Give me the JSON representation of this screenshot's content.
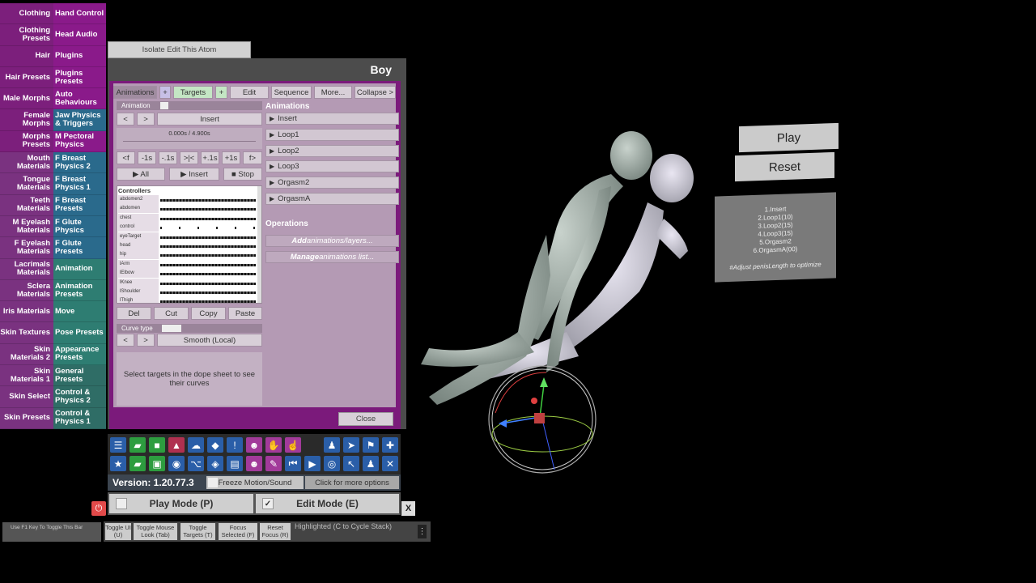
{
  "categories_left": [
    "Clothing",
    "Clothing Presets",
    "Hair",
    "Hair Presets",
    "Male Morphs",
    "Female Morphs",
    "Morphs Presets",
    "Mouth Materials",
    "Tongue Materials",
    "Teeth Materials",
    "M Eyelash Materials",
    "F Eyelash Materials",
    "Lacrimals Materials",
    "Sclera Materials",
    "Iris Materials",
    "Skin Textures",
    "Skin Materials 2",
    "Skin Materials 1",
    "Skin Select",
    "Skin Presets"
  ],
  "categories_right": [
    "Hand Control",
    "Head Audio",
    "Plugins",
    "Plugins Presets",
    "Auto Behaviours",
    "Jaw Physics & Triggers",
    "M Pectoral Physics",
    "F Breast Physics 2",
    "F Breast Physics 1",
    "F Breast Presets",
    "F Glute Physics",
    "F Glute Presets",
    "Animation",
    "Animation Presets",
    "Move",
    "Pose Presets",
    "Appearance Presets",
    "General Presets",
    "Control & Physics 2",
    "Control & Physics 1"
  ],
  "isolate_label": "Isolate Edit This Atom",
  "panel": {
    "title": "Boy",
    "tabs": {
      "animations": "Animations",
      "plus1": "+",
      "targets": "Targets",
      "plus2": "+",
      "edit": "Edit",
      "sequence": "Sequence",
      "more": "More...",
      "collapse": "Collapse >"
    },
    "animation_label": "Animation",
    "prev": "<",
    "next": ">",
    "insert": "Insert",
    "time": "0.000s / 4.900s",
    "step_buttons": [
      "<f",
      "-1s",
      "-.1s",
      ">|<",
      "+.1s",
      "+1s",
      "f>"
    ],
    "play_all": "▶ All",
    "play_insert": "▶ Insert",
    "stop": "■ Stop",
    "controllers_title": "Controllers",
    "controllers": [
      "abdomen2",
      "abdomen",
      "chest",
      "control",
      "eyeTarget",
      "head",
      "hip",
      "lArm",
      "lElbow",
      "lKnee",
      "lShoulder",
      "lThigh"
    ],
    "edit_buttons": [
      "Del",
      "Cut",
      "Copy",
      "Paste"
    ],
    "curve_type_label": "Curve type",
    "curve_value": "Smooth (Local)",
    "select_info": "Select targets in the dope sheet to see their curves",
    "animations_title": "Animations",
    "animations": [
      "Insert",
      "Loop1",
      "Loop2",
      "Loop3",
      "Orgasm2",
      "OrgasmA"
    ],
    "operations_title": "Operations",
    "op_add_bold": "Add",
    "op_add_rest": " animations/layers...",
    "op_manage_bold": "Manage",
    "op_manage_rest": " animations list...",
    "close": "Close"
  },
  "toolbar": {
    "version": "Version: 1.20.77.3",
    "freeze": "Freeze Motion/Sound",
    "more_options": "Click for more options",
    "play_mode": "Play Mode (P)",
    "edit_mode": "Edit Mode (E)",
    "edit_check": "✓",
    "close_x": "X",
    "power": "⏻"
  },
  "bottom": {
    "f1_hint": "Use F1 Key To Toggle This Bar",
    "toggle_ui": "Toggle UI (U)",
    "toggle_mouse": "Toggle Mouse Look (Tab)",
    "toggle_targets": "Toggle Targets (T)",
    "focus_selected": "Focus Selected (F)",
    "reset_focus": "Reset Focus (R)",
    "highlighted": "Highlighted (C to Cycle Stack)",
    "menu": "⋮"
  },
  "scene": {
    "play": "Play",
    "reset": "Reset",
    "list": [
      "1.Insert",
      "2.Loop1(10)",
      "3.Loop2(15)",
      "4.Loop3(15)",
      "5.Orgasm2",
      "6.OrgasmA(00)"
    ],
    "note": "#Adjust penisLength to optimize"
  },
  "colors": {
    "panel_purple": "#7b1a7b",
    "panel_body": "#b49ab4",
    "menu_magenta": "#7c1f7c",
    "menu_blue": "#2a6a8c",
    "menu_teal": "#2e7d72"
  }
}
